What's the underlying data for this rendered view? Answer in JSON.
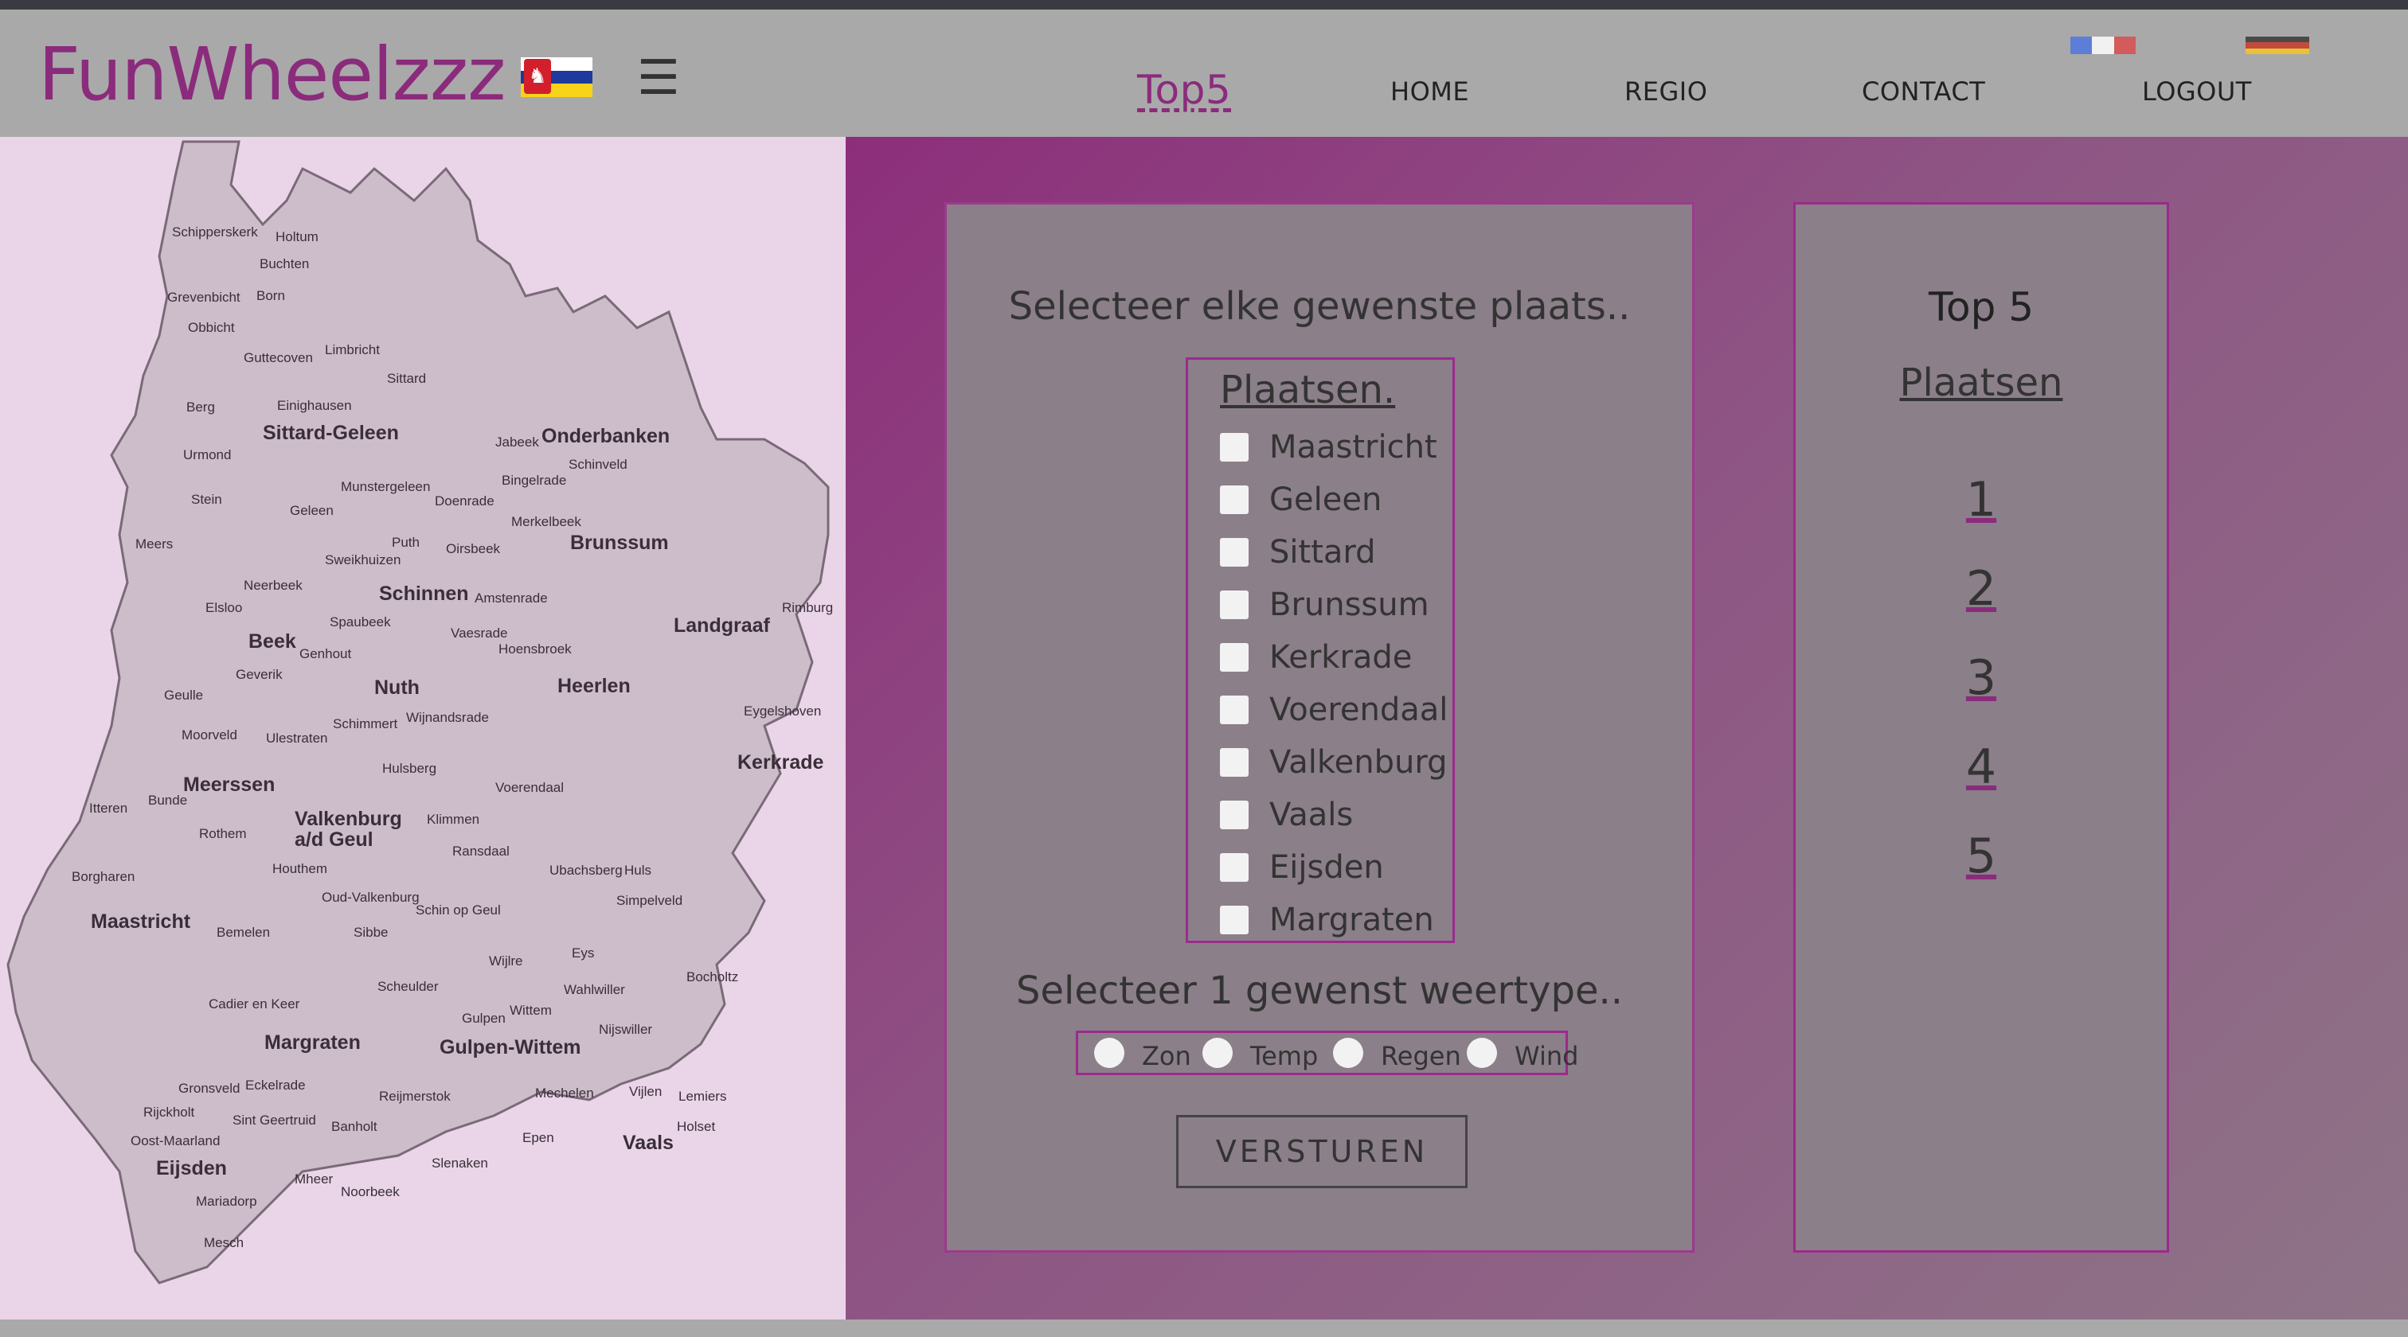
{
  "app": {
    "logo": "FunWheelzzz"
  },
  "nav": {
    "hamburger": "☰",
    "links": [
      "Top5",
      "HOME",
      "REGIO",
      "CONTACT",
      "LOGOUT"
    ]
  },
  "icons": {
    "province_flag": "limburg-flag-icon",
    "lang_fr": "french-flag-icon",
    "lang_de": "german-flag-icon",
    "menu": "hamburger-menu-icon"
  },
  "colors": {
    "brand": "#8b2b7c",
    "panel": "#8b7f89",
    "border": "#9c2a8c",
    "navbar": "#a9a9a9"
  },
  "map": {
    "places": [
      "Schipperskerk",
      "Holtum",
      "Buchten",
      "Grevenbicht",
      "Born",
      "Obbicht",
      "Guttecoven",
      "Limbricht",
      "Sittard",
      "Berg",
      "Einighausen",
      "Sittard-Geleen",
      "Urmond",
      "Jabeek",
      "Onderbanken",
      "Schinveld",
      "Munstergeleen",
      "Bingelrade",
      "Stein",
      "Geleen",
      "Doenrade",
      "Merkelbeek",
      "Meers",
      "Puth",
      "Oirsbeek",
      "Brunssum",
      "Sweikhuizen",
      "Schinnen",
      "Neerbeek",
      "Amstenrade",
      "Elsloo",
      "Beek",
      "Spaubeek",
      "Vaesrade",
      "Hoensbroek",
      "Landgraaf",
      "Rimburg",
      "Genhout",
      "Geverik",
      "Nuth",
      "Heerlen",
      "Geulle",
      "Moorveld",
      "Schimmert",
      "Wijnandsrade",
      "Ulestraten",
      "Eygelshoven",
      "Hulsberg",
      "Voerendaal",
      "Kerkrade",
      "Meerssen",
      "Bunde",
      "Itteren",
      "Rothem",
      "Valkenburg a/d Geul",
      "Klimmen",
      "Ransdaal",
      "Borgharen",
      "Houthem",
      "Ubachsberg",
      "Huls",
      "Simpelveld",
      "Oud-Valkenburg",
      "Schin op Geul",
      "Maastricht",
      "Bemelen",
      "Sibbe",
      "Wijlre",
      "Eys",
      "Bocholtz",
      "Cadier en Keer",
      "Scheulder",
      "Margraten",
      "Gulpen",
      "Wittem",
      "Wahlwiller",
      "Nijswiller",
      "Gulpen-Wittem",
      "Gronsveld",
      "Eckelrade",
      "Reijmerstok",
      "Mechelen",
      "Vijlen",
      "Lemiers",
      "Rijckholt",
      "Sint Geertruid",
      "Banholt",
      "Holset",
      "Vaals",
      "Oost-Maarland",
      "Epen",
      "Eijsden",
      "Mheer",
      "Noorbeek",
      "Slenaken",
      "Mariadorp",
      "Mesch"
    ]
  },
  "form": {
    "title": "Selecteer elke gewenste plaats..",
    "places_title": "Plaatsen.",
    "places": [
      "Maastricht",
      "Geleen",
      "Sittard",
      "Brunssum",
      "Kerkrade",
      "Voerendaal",
      "Valkenburg",
      "Vaals",
      "Eijsden",
      "Margraten"
    ],
    "weather_title": "Selecteer 1 gewenst weertype..",
    "weather_types": [
      "Zon",
      "Temp",
      "Regen",
      "Wind"
    ],
    "submit": "VERSTUREN"
  },
  "top5": {
    "title": "Top 5",
    "subtitle": "Plaatsen",
    "ranks": [
      "1",
      "2",
      "3",
      "4",
      "5"
    ]
  }
}
